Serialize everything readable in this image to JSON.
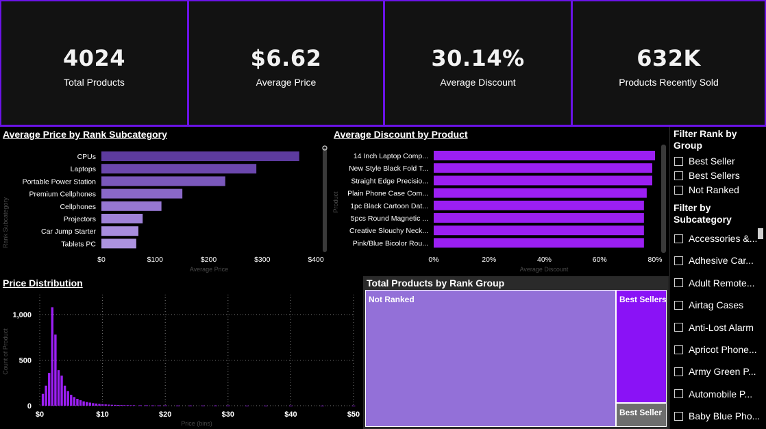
{
  "kpis": [
    {
      "value": "4024",
      "label": "Total Products"
    },
    {
      "value": "$6.62",
      "label": "Average Price"
    },
    {
      "value": "30.14%",
      "label": "Average Discount"
    },
    {
      "value": "632K",
      "label": "Products Recently Sold"
    }
  ],
  "avg_price_chart": {
    "title": "Average Price by Rank Subcategory",
    "xlabel": "Average Price",
    "ylabel": "Rank Subcategory",
    "ticks": [
      "$0",
      "$100",
      "$200",
      "$300",
      "$400"
    ]
  },
  "avg_discount_chart": {
    "title": "Average Discount by Product",
    "xlabel": "Average Discount",
    "ylabel": "Product",
    "ticks": [
      "0%",
      "20%",
      "40%",
      "60%",
      "80%"
    ]
  },
  "price_dist_chart": {
    "title": "Price Distribution",
    "xlabel": "Price (bins)",
    "ylabel": "Count of Product",
    "xticks": [
      "$0",
      "$10",
      "$20",
      "$30",
      "$40",
      "$50"
    ],
    "yticks": [
      "0",
      "500",
      "1,000"
    ]
  },
  "treemap": {
    "title": "Total Products by Rank Group",
    "tiles": [
      {
        "label": "Not Ranked",
        "color": "#9370d8"
      },
      {
        "label": "Best Sellers",
        "color": "#8a12f6"
      },
      {
        "label": "Best Seller",
        "color": "#6e6e6e"
      }
    ]
  },
  "slicer": {
    "rank_header": "Filter Rank by Group",
    "rank_items": [
      "Best Seller",
      "Best Sellers",
      "Not Ranked"
    ],
    "sub_header": "Filter by Subcategory",
    "sub_items": [
      "Accessories &...",
      "Adhesive Car...",
      "Adult Remote...",
      "Airtag Cases",
      "Anti-Lost Alarm",
      "Apricot Phone...",
      "Army Green P...",
      "Automobile P...",
      "Baby Blue Pho..."
    ]
  },
  "colors": {
    "accent": "#6a13e6",
    "bar_purple": "#9b1ff2",
    "card_bg": "#121212"
  },
  "chart_data": [
    {
      "type": "bar",
      "orientation": "horizontal",
      "title": "Average Price by Rank Subcategory",
      "xlabel": "Average Price",
      "ylabel": "Rank Subcategory",
      "categories": [
        "CPUs",
        "Laptops",
        "Portable Power Station",
        "Premium Cellphones",
        "Cellphones",
        "Projectors",
        "Car Jump Starter",
        "Tablets PC"
      ],
      "values": [
        369,
        289,
        231,
        151,
        112,
        77,
        69,
        65
      ],
      "colors": [
        "#5d3b9e",
        "#6b47ad",
        "#7a58bb",
        "#8a68c8",
        "#9677d2",
        "#9f82d8",
        "#a88dde",
        "#ad93e0"
      ],
      "xlim": [
        0,
        420
      ],
      "grid": false
    },
    {
      "type": "bar",
      "orientation": "horizontal",
      "title": "Average Discount by Product",
      "xlabel": "Average Discount",
      "ylabel": "Product",
      "categories": [
        "14 Inch Laptop Comp...",
        "New Style Black Fold T...",
        "Straight Edge Precisio...",
        "Plain Phone Case Com...",
        "1pc Black Cartoon Dat...",
        "5pcs Round Magnetic ...",
        "Creative Slouchy Neck...",
        "Pink/Blue Bicolor Rou..."
      ],
      "values": [
        80,
        79,
        79,
        77,
        76,
        76,
        76,
        76
      ],
      "xlim": [
        0,
        81.5
      ],
      "grid": false
    },
    {
      "type": "bar",
      "title": "Price Distribution",
      "xlabel": "Price (bins)",
      "ylabel": "Count of Product",
      "x": [
        0.5,
        1.0,
        1.5,
        2.0,
        2.5,
        3.0,
        3.5,
        4.0,
        4.5,
        5.0,
        5.5,
        6.0,
        6.5,
        7.0,
        7.5,
        8.0,
        8.5,
        9.0,
        9.5,
        10.0,
        10.5,
        11.0,
        11.5,
        12.0,
        12.5,
        13.0,
        13.5,
        14.0,
        14.5,
        15.0,
        16,
        17,
        18,
        19,
        20,
        22,
        24,
        26,
        28,
        30,
        33,
        36,
        40,
        45,
        50
      ],
      "values": [
        130,
        220,
        360,
        1080,
        780,
        390,
        330,
        220,
        160,
        120,
        95,
        75,
        60,
        48,
        40,
        34,
        28,
        24,
        20,
        16,
        14,
        12,
        10,
        9,
        8,
        7,
        6,
        6,
        5,
        5,
        4,
        4,
        3,
        3,
        3,
        2,
        2,
        2,
        2,
        2,
        1,
        1,
        1,
        1,
        1
      ],
      "xlim": [
        0,
        50
      ],
      "ylim": [
        0,
        1150
      ],
      "grid": true
    },
    {
      "type": "treemap",
      "title": "Total Products by Rank Group",
      "categories": [
        "Not Ranked",
        "Best Sellers",
        "Best Seller"
      ],
      "values": [
        3260,
        585,
        179
      ]
    }
  ]
}
